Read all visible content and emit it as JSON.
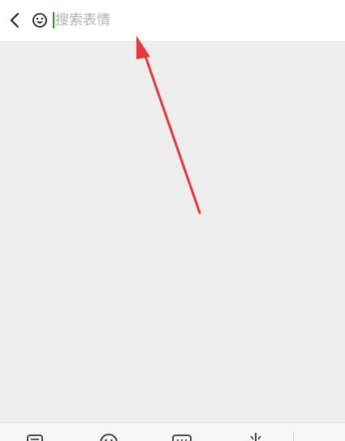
{
  "search": {
    "placeholder": "搜索表情",
    "value": ""
  },
  "colors": {
    "caret": "#1aad19",
    "annotation_arrow": "#e53935"
  },
  "icons": {
    "back": "chevron-left-icon",
    "emoji": "smiley-icon",
    "toolbar": [
      "sticker-icon",
      "smiley-icon",
      "keyboard-icon",
      "scissors-icon",
      "more-icon"
    ]
  }
}
